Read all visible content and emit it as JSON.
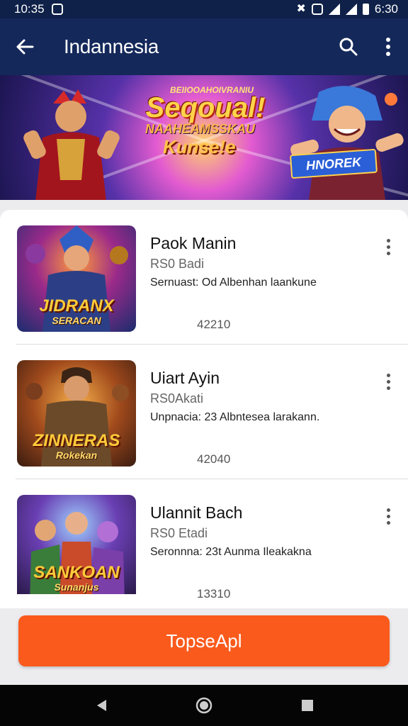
{
  "status_bar": {
    "time": "10:35",
    "battery_time": "6:30"
  },
  "app_bar": {
    "title": "Indannesia"
  },
  "banner": {
    "small_text": "BEIIOOAHOIVRANIU",
    "title": "Seqoual!",
    "line2": "NAAHEAMSSKAU",
    "line3": "Kunse!e",
    "badge": "HNOREK"
  },
  "games": [
    {
      "title": "Paok Manin",
      "subtitle": "RS0 Badi",
      "description": "Sernuast: Od Albenhan laankune",
      "count": "42210",
      "thumb_label": "JIDRANX",
      "thumb_sub": "SERACAN"
    },
    {
      "title": "Uiart Ayin",
      "subtitle": "RS0Akati",
      "description": "Unpnacia: 23 Albntesea larakann.",
      "count": "42040",
      "thumb_label": "ZINNERAS",
      "thumb_sub": "Rokekan"
    },
    {
      "title": "Ulannit Bach",
      "subtitle": "RS0 Etadi",
      "description": "Seronnna: 23t Aunma Ileakakna",
      "count": "13310",
      "thumb_label": "SANKOAN",
      "thumb_sub": "Sunanjus"
    }
  ],
  "cta": {
    "label": "TopseApl"
  },
  "colors": {
    "header": "#14285a",
    "status": "#0f2149",
    "accent": "#fa5a1c"
  }
}
